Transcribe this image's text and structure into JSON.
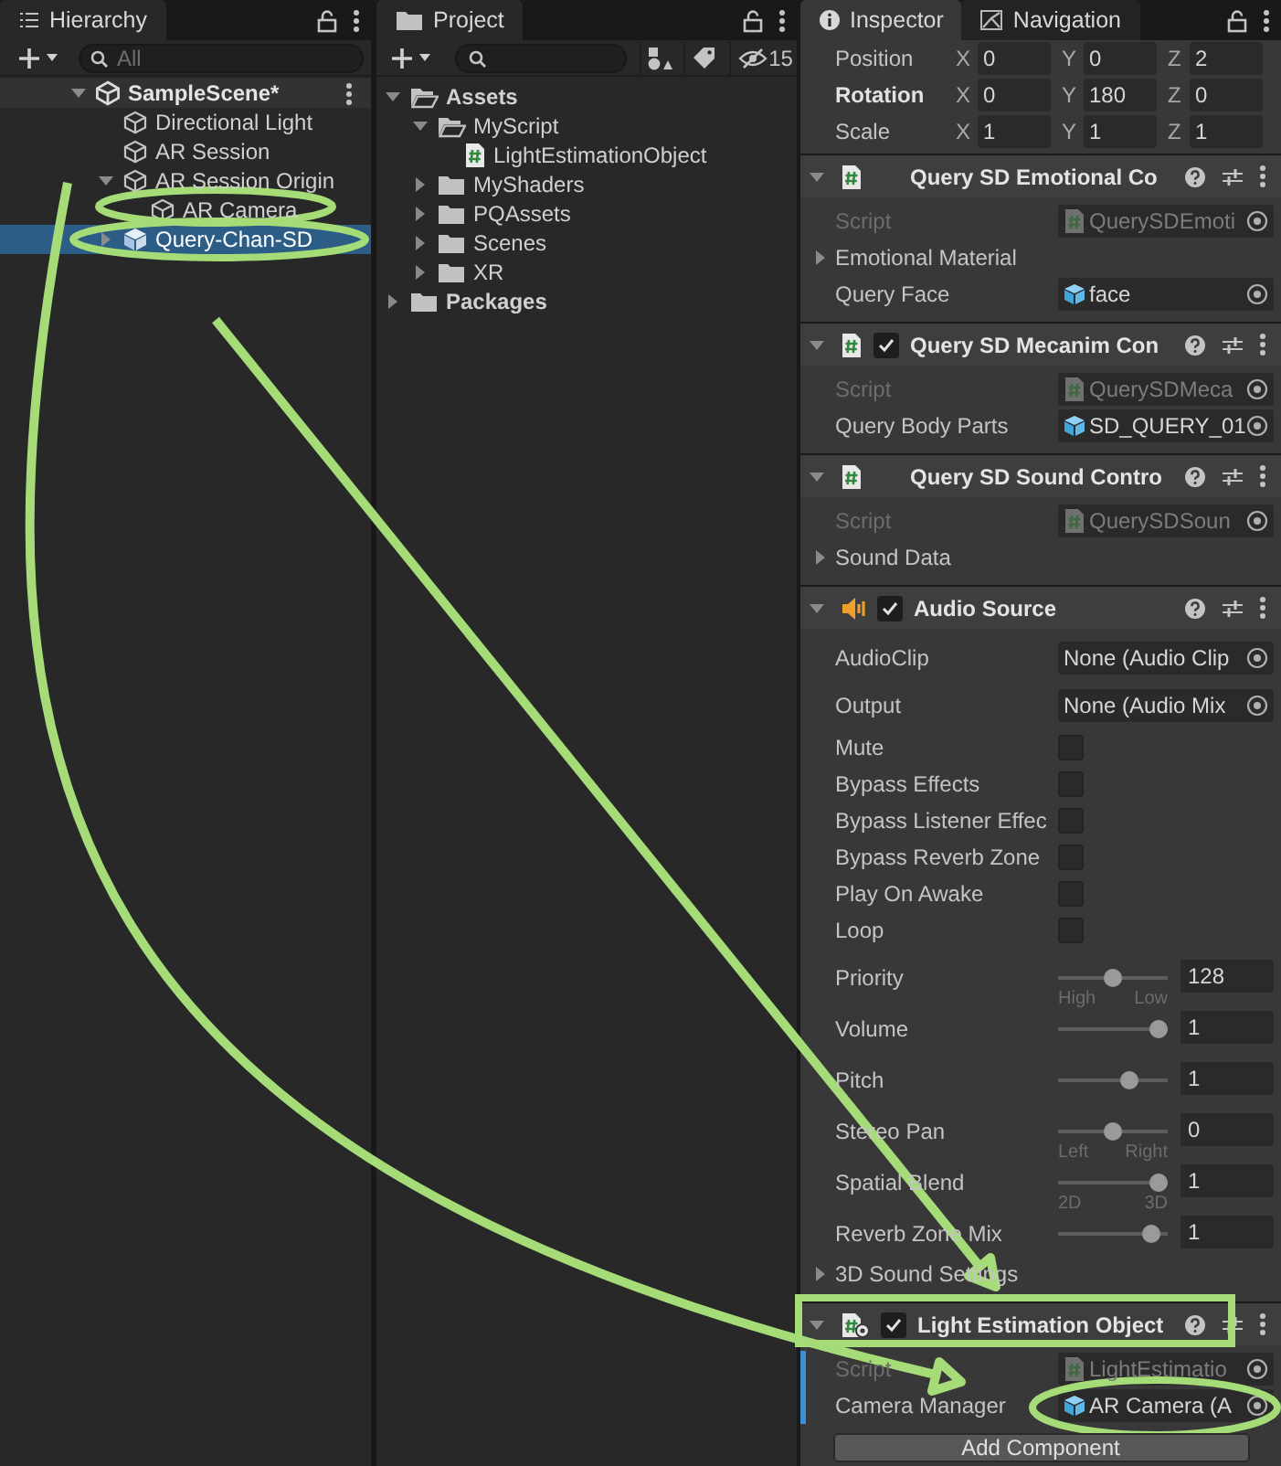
{
  "hierarchy": {
    "tab": "Hierarchy",
    "search": {
      "placeholder": "All"
    },
    "items": [
      {
        "label": "SampleScene*",
        "kind": "scene",
        "expanded": true,
        "selected": false,
        "children": [
          {
            "label": "Directional Light",
            "kind": "object",
            "selected": false
          },
          {
            "label": "AR Session",
            "kind": "object",
            "selected": false
          },
          {
            "label": "AR Session Origin",
            "kind": "object",
            "expanded": true,
            "selected": false,
            "children": [
              {
                "label": "AR Camera",
                "kind": "object",
                "selected": false
              }
            ]
          },
          {
            "label": "Query-Chan-SD",
            "kind": "prefab",
            "expanded": false,
            "selected": true
          }
        ]
      }
    ]
  },
  "project": {
    "tab": "Project",
    "hidden_count": "15",
    "items": [
      {
        "label": "Assets",
        "kind": "folder",
        "expanded": true,
        "children": [
          {
            "label": "MyScript",
            "kind": "folder",
            "expanded": true,
            "children": [
              {
                "label": "LightEstimationObject",
                "kind": "script"
              }
            ]
          },
          {
            "label": "MyShaders",
            "kind": "folder",
            "expanded": false
          },
          {
            "label": "PQAssets",
            "kind": "folder",
            "expanded": false
          },
          {
            "label": "Scenes",
            "kind": "folder",
            "expanded": false
          },
          {
            "label": "XR",
            "kind": "folder",
            "expanded": false
          }
        ]
      },
      {
        "label": "Packages",
        "kind": "folder",
        "expanded": false
      }
    ]
  },
  "inspector": {
    "tabs": [
      {
        "label": "Inspector",
        "selected": true
      },
      {
        "label": "Navigation",
        "selected": false
      }
    ],
    "transform": [
      {
        "label": "Position",
        "modified": false,
        "values": [
          {
            "axis": "X",
            "value": "0"
          },
          {
            "axis": "Y",
            "value": "0"
          },
          {
            "axis": "Z",
            "value": "2"
          }
        ]
      },
      {
        "label": "Rotation",
        "modified": true,
        "values": [
          {
            "axis": "X",
            "value": "0"
          },
          {
            "axis": "Y",
            "value": "180"
          },
          {
            "axis": "Z",
            "value": "0"
          }
        ]
      },
      {
        "label": "Scale",
        "modified": false,
        "values": [
          {
            "axis": "X",
            "value": "1"
          },
          {
            "axis": "Y",
            "value": "1"
          },
          {
            "axis": "Z",
            "value": "1"
          }
        ]
      }
    ],
    "components": [
      {
        "title": "Query SD Emotional Co",
        "kind": "script",
        "overridden": false,
        "properties": [
          {
            "kind": "script_field",
            "label": "Script",
            "value": "QuerySDEmoti",
            "disabled": true
          },
          {
            "kind": "foldout",
            "label": "Emotional Material"
          },
          {
            "kind": "object_field",
            "label": "Query Face",
            "value": "face",
            "disabled": false
          }
        ]
      },
      {
        "title": "Query SD Mecanim Con",
        "kind": "script",
        "enabled": true,
        "overridden": false,
        "properties": [
          {
            "kind": "script_field",
            "label": "Script",
            "value": "QuerySDMeca",
            "disabled": true
          },
          {
            "kind": "object_field",
            "label": "Query Body Parts",
            "value": "SD_QUERY_01",
            "disabled": false
          }
        ]
      },
      {
        "title": "Query SD Sound Contro",
        "kind": "script",
        "overridden": false,
        "properties": [
          {
            "kind": "script_field",
            "label": "Script",
            "value": "QuerySDSoun",
            "disabled": true
          },
          {
            "kind": "foldout",
            "label": "Sound Data"
          }
        ]
      },
      {
        "title": "Audio Source",
        "kind": "audio",
        "enabled": true,
        "overridden": false,
        "properties": [
          {
            "kind": "empty_field",
            "label": "AudioClip",
            "value": "None (Audio Clip",
            "disabled": false
          },
          {
            "kind": "empty_field",
            "label": "Output",
            "value": "None (Audio Mix",
            "disabled": false
          },
          {
            "kind": "checkbox",
            "label": "Mute",
            "checked": false
          },
          {
            "kind": "checkbox",
            "label": "Bypass Effects",
            "checked": false
          },
          {
            "kind": "checkbox",
            "label": "Bypass Listener Effec",
            "checked": false
          },
          {
            "kind": "checkbox",
            "label": "Bypass Reverb Zone",
            "checked": false
          },
          {
            "kind": "checkbox",
            "label": "Play On Awake",
            "checked": false
          },
          {
            "kind": "checkbox",
            "label": "Loop",
            "checked": false
          },
          {
            "kind": "slider",
            "label": "Priority",
            "level": 0.5,
            "value": "128",
            "captions": [
              "High",
              "Low"
            ]
          },
          {
            "kind": "slider",
            "label": "Volume",
            "level": 1,
            "value": "1"
          },
          {
            "kind": "slider",
            "label": "Pitch",
            "level": 0.67,
            "value": "1"
          },
          {
            "kind": "slider",
            "label": "Stereo Pan",
            "level": 0.5,
            "value": "0",
            "captions": [
              "Left",
              "Right"
            ]
          },
          {
            "kind": "slider",
            "label": "Spatial Blend",
            "level": 1,
            "value": "1",
            "captions": [
              "2D",
              "3D"
            ]
          },
          {
            "kind": "slider",
            "label": "Reverb Zone Mix",
            "level": 0.91,
            "value": "1"
          },
          {
            "kind": "foldout",
            "label": "3D Sound Settings"
          }
        ]
      },
      {
        "title": "Light Estimation Object",
        "kind": "custom_script",
        "enabled": true,
        "overridden": true,
        "properties": [
          {
            "kind": "script_field",
            "label": "Script",
            "value": "LightEstimatio",
            "disabled": true
          },
          {
            "kind": "object_field",
            "label": "Camera Manager",
            "value": "AR Camera (A",
            "disabled": false
          }
        ]
      }
    ],
    "add_button": "Add Component"
  }
}
